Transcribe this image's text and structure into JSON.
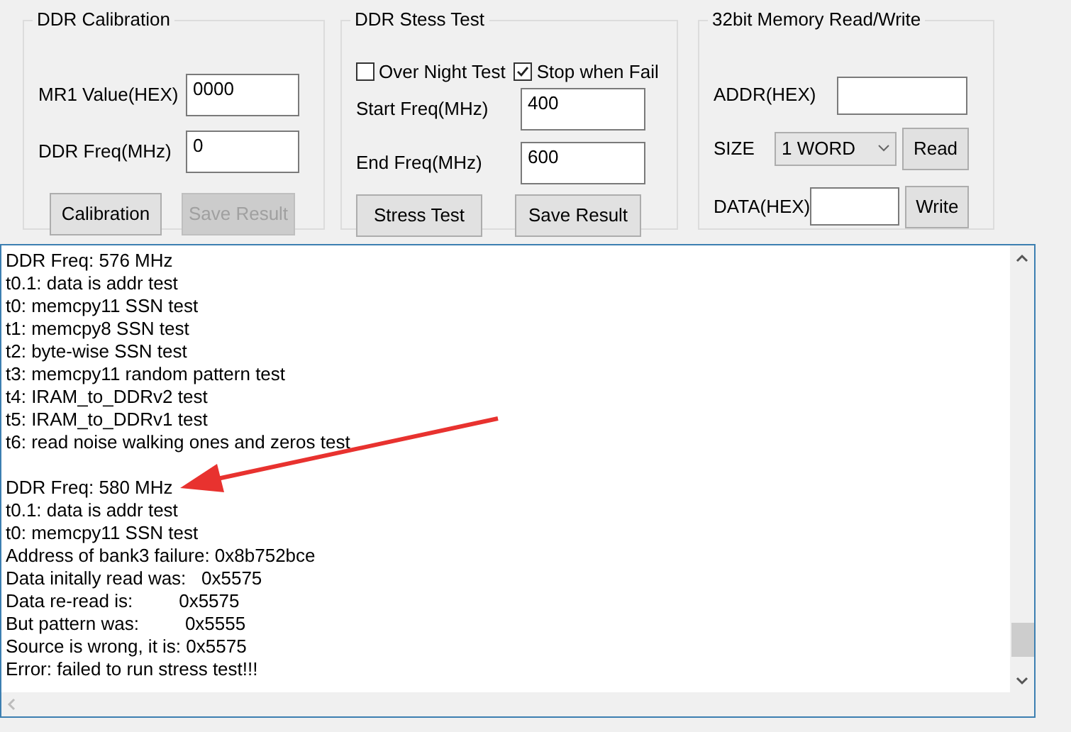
{
  "calibration": {
    "title": "DDR Calibration",
    "fields": [
      {
        "label": "MR1 Value(HEX)",
        "value": "0000"
      },
      {
        "label": "DDR Freq(MHz)",
        "value": "0"
      }
    ],
    "buttons": [
      {
        "label": "Calibration",
        "disabled": false
      },
      {
        "label": "Save Result",
        "disabled": true
      }
    ]
  },
  "stress_test": {
    "title": "DDR Stess Test",
    "checkboxes": [
      {
        "label": "Over Night Test",
        "checked": false
      },
      {
        "label": "Stop when Fail",
        "checked": true
      }
    ],
    "fields": [
      {
        "label": "Start Freq(MHz)",
        "value": "400"
      },
      {
        "label": "End Freq(MHz)",
        "value": "600"
      }
    ],
    "buttons": [
      {
        "label": "Stress Test",
        "disabled": false
      },
      {
        "label": "Save Result",
        "disabled": false
      }
    ]
  },
  "memory": {
    "title": "32bit Memory Read/Write",
    "rows": [
      {
        "kind": "text",
        "label": "ADDR(HEX)"
      },
      {
        "kind": "select",
        "label": "SIZE",
        "value": "1 WORD",
        "button": "Read"
      },
      {
        "kind": "text",
        "label": "DATA(HEX)",
        "button": "Write"
      }
    ]
  },
  "log": {
    "blocks": [
      [
        "DDR Freq: 576 MHz",
        "t0.1: data is addr test",
        "t0: memcpy11 SSN test",
        "t1: memcpy8 SSN test",
        "t2: byte-wise SSN test",
        "t3: memcpy11 random pattern test",
        "t4: IRAM_to_DDRv2 test",
        "t5: IRAM_to_DDRv1 test",
        "t6: read noise walking ones and zeros test"
      ],
      [
        "DDR Freq: 580 MHz",
        "t0.1: data is addr test",
        "t0: memcpy11 SSN test",
        "Address of bank3 failure: 0x8b752bce",
        "Data initally read was:   0x5575",
        "Data re-read is:         0x5575",
        "But pattern was:         0x5555",
        "Source is wrong, it is: 0x5575",
        "Error: failed to run stress test!!!"
      ]
    ]
  }
}
